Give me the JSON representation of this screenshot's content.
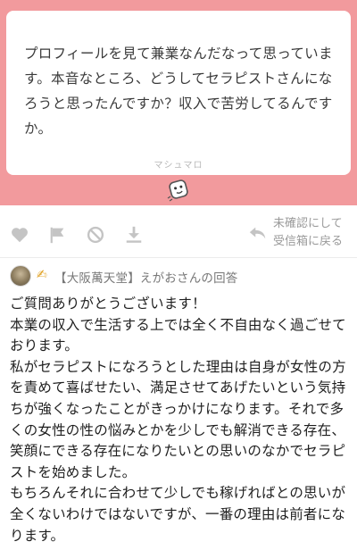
{
  "question": {
    "text": "プロフィールを見て兼業なんだなって思っています。本音なところ、どうしてセラピストさんになろうと思ったんですか？収入で苦労してるんですか。",
    "brand": "マシュマロ"
  },
  "actions": {
    "icons": [
      "heart-icon",
      "flag-icon",
      "block-icon",
      "download-icon"
    ],
    "return_line1": "未確認にして",
    "return_line2": "受信箱に戻る"
  },
  "answer": {
    "header": "【大阪萬天堂】えがおさんの回答",
    "paragraphs": [
      "ご質問ありがとうございます！",
      "本業の収入で生活する上では全く不自由なく過ごせております。",
      "私がセラピストになろうとした理由は自身が女性の方を責めて喜ばせたい、満足させてあげたいという気持ちが強くなったことがきっかけになります。それで多くの女性の性の悩みとかを少しでも解消できる存在、笑顔にできる存在になりたいとの思いのなかでセラピストを始めました。",
      "もちろんそれに合わせて少しでも稼げればとの思いが全くないわけではないですが、一番の理由は前者になります。"
    ]
  },
  "colors": {
    "banner": "#f29a9d",
    "icon_gray": "#c4c4c4",
    "hand": "#e0a020"
  }
}
